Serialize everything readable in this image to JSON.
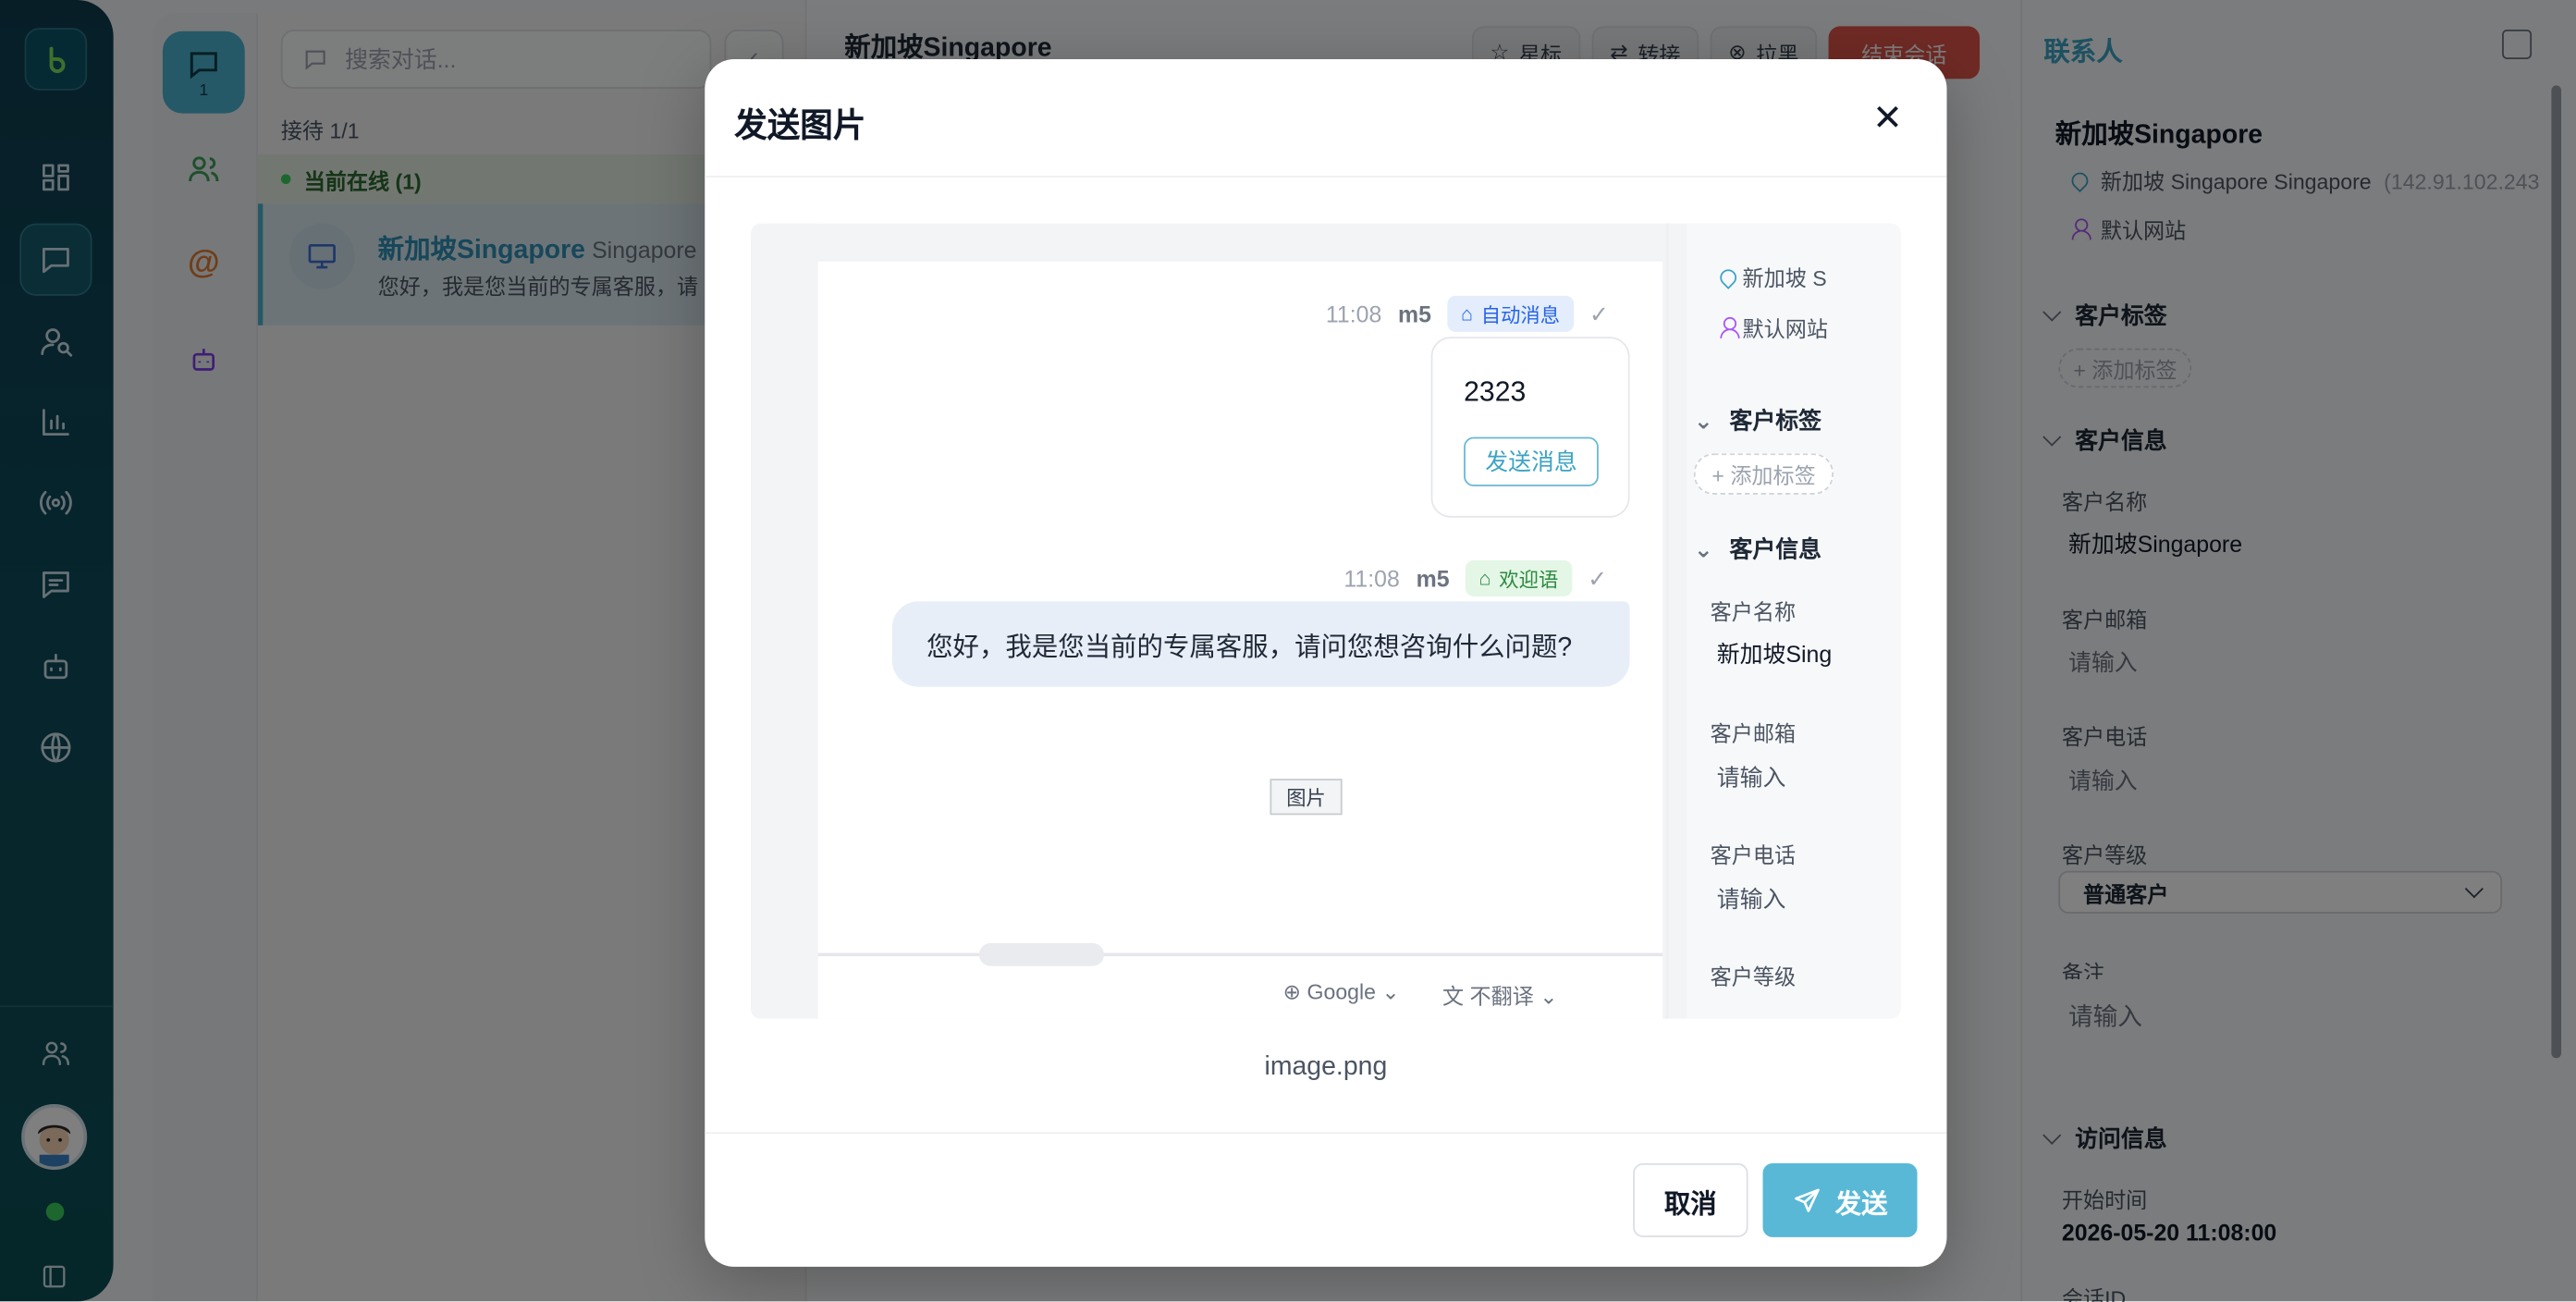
{
  "sidebar": {
    "nav_icons": [
      "dashboard-icon",
      "chat-icon",
      "user-search-icon",
      "chart-icon",
      "broadcast-icon",
      "message-icon",
      "robot-icon",
      "globe-icon"
    ],
    "bottom_icons": [
      "team-icon",
      "avatar",
      "online-dot",
      "collapse-icon"
    ]
  },
  "secondary": {
    "chat_count": "1"
  },
  "list": {
    "search_placeholder": "搜索对话...",
    "reception": "接待 1/1",
    "online_section": "当前在线 (1)",
    "conversation": {
      "name": "新加坡Singapore",
      "location": "Singapore",
      "preview": "您好，我是您当前的专属客服，请"
    }
  },
  "chat": {
    "title": "新加坡Singapore",
    "star_label": "星标",
    "transfer_label": "转接",
    "pull_label": "拉黑",
    "end_label": "结束会话"
  },
  "contact": {
    "header": "联系人",
    "name": "新加坡Singapore",
    "location": "新加坡 Singapore Singapore",
    "ip": "(142.91.102.243",
    "site": "默认网站",
    "tags_section": "客户标签",
    "add_tag": "+ 添加标签",
    "info_section": "客户信息",
    "customer_name_label": "客户名称",
    "customer_name": "新加坡Singapore",
    "email_label": "客户邮箱",
    "email_placeholder": "请输入",
    "phone_label": "客户电话",
    "phone_placeholder": "请输入",
    "level_label": "客户等级",
    "level_value": "普通客户",
    "note_label": "备注",
    "note_placeholder": "请输入",
    "visit_section": "访问信息",
    "start_time_label": "开始时间",
    "start_time": "2026-05-20 11:08:00",
    "session_id_label": "会话ID"
  },
  "modal": {
    "title": "发送图片",
    "filename": "image.png",
    "cancel_label": "取消",
    "send_label": "发送",
    "preview": {
      "msg1_time": "11:08",
      "msg1_agent": "m5",
      "msg1_tag": "自动消息",
      "card_number": "2323",
      "card_button": "发送消息",
      "msg2_time": "11:08",
      "msg2_agent": "m5",
      "msg2_tag": "欢迎语",
      "msg2_text": "您好，我是您当前的专属客服，请问您想咨询什么问题?",
      "image_tag": "图片",
      "translate_engine": "Google",
      "translate_mode": "不翻译",
      "right_location": "新加坡 S",
      "right_site": "默认网站",
      "right_tags_section": "客户标签",
      "right_add_tag": "+ 添加标签",
      "right_info_section": "客户信息",
      "right_name_label": "客户名称",
      "right_name": "新加坡Sing",
      "right_email_label": "客户邮箱",
      "right_email": "请输入",
      "right_phone_label": "客户电话",
      "right_phone": "请输入",
      "right_level_label": "客户等级"
    }
  },
  "colors": {
    "accent": "#4ab3cf",
    "rail": "#0f3d4f",
    "danger": "#e0544a",
    "online": "#3bcf5f"
  }
}
